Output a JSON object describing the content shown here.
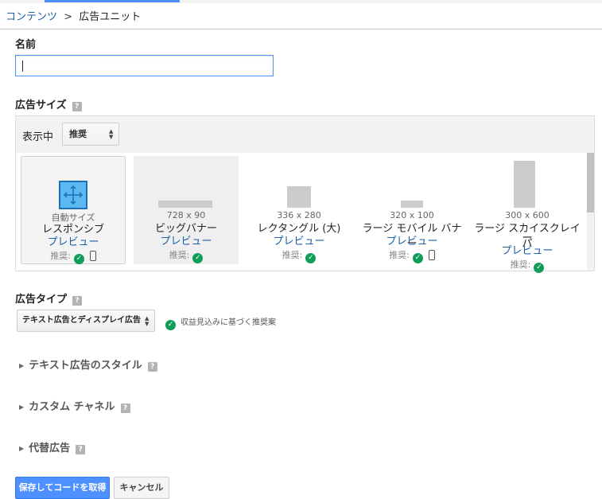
{
  "breadcrumb": {
    "parent": "コンテンツ",
    "separator": ">",
    "current": "広告ユニット"
  },
  "name_section": {
    "label": "名前",
    "input_value": ""
  },
  "ad_size": {
    "label": "広告サイズ",
    "help": "?",
    "display_label": "表示中",
    "display_select": "推奨",
    "cards": [
      {
        "sub": "自動サイズ",
        "name": "レスポンシブ",
        "preview": "プレビュー",
        "rec": "推奨:",
        "mobile": true,
        "selected": true
      },
      {
        "sub": "728 x 90",
        "name": "ビッグバナー",
        "preview": "プレビュー",
        "rec": "推奨:",
        "mobile": false
      },
      {
        "sub": "336 x 280",
        "name": "レクタングル (大)",
        "preview": "プレビュー",
        "rec": "推奨:",
        "mobile": false
      },
      {
        "sub": "320 x 100",
        "name": "ラージ モバイル バナー",
        "preview": "プレビュー",
        "rec": "推奨:",
        "mobile": true
      },
      {
        "sub": "300 x 600",
        "name_line1": "ラージ スカイスクレイパ",
        "name_line2": "ー",
        "preview": "プレビュー",
        "rec": "推奨:",
        "mobile": false
      }
    ]
  },
  "ad_type": {
    "label": "広告タイプ",
    "help": "?",
    "select_value": "テキスト広告とディスプレイ広告",
    "note": "収益見込みに基づく推奨案"
  },
  "sections": {
    "text_style": "テキスト広告のスタイル",
    "custom_channel": "カスタム チャネル",
    "backup_ads": "代替広告"
  },
  "buttons": {
    "save": "保存してコードを取得",
    "cancel": "キャンセル"
  },
  "colors": {
    "accent": "#4d90fe",
    "link": "#1a5ea8",
    "check": "#109d59"
  }
}
